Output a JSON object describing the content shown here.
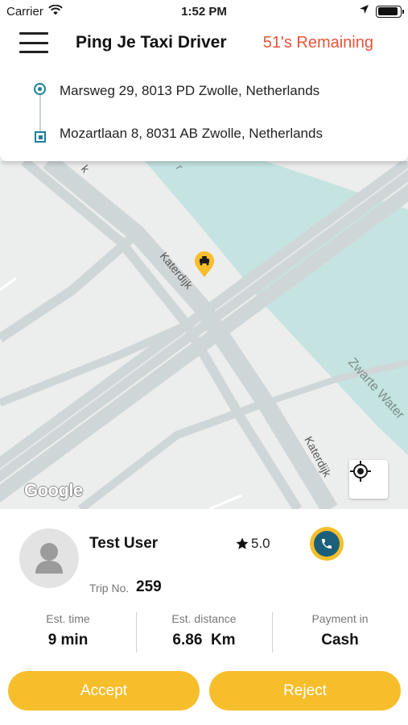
{
  "status_bar": {
    "carrier": "Carrier",
    "time": "1:52 PM",
    "icons": [
      "wifi-icon",
      "location-arrow-icon",
      "battery-icon"
    ],
    "battery_level": 0.9
  },
  "header": {
    "title": "Ping Je Taxi Driver",
    "remaining": "51's Remaining",
    "remaining_color": "#e8543a"
  },
  "route": {
    "pickup": "Marsweg 29, 8013 PD Zwolle, Netherlands",
    "dropoff": "Mozartlaan 8, 8031 AB Zwolle, Netherlands",
    "marker_color": "#1c7d9a"
  },
  "map": {
    "street_labels": [
      "Katerdijk",
      "Katerdijk",
      "Zwarte Water"
    ],
    "logo": "Google",
    "vehicle_icon": "taxi-marker-icon",
    "water_color": "#c4e3e1",
    "land_color": "#eceded",
    "road_color": "#cfd6d8"
  },
  "rider": {
    "name": "Test User",
    "rating": "5.0",
    "trip_label": "Trip No.",
    "trip_no": "259"
  },
  "stats": [
    {
      "label": "Est. time",
      "value": "9 min"
    },
    {
      "label": "Est. distance",
      "value": "6.86  Km"
    },
    {
      "label": "Payment in",
      "value": "Cash"
    }
  ],
  "actions": {
    "accept": "Accept",
    "reject": "Reject",
    "button_color": "#f7be2c"
  }
}
